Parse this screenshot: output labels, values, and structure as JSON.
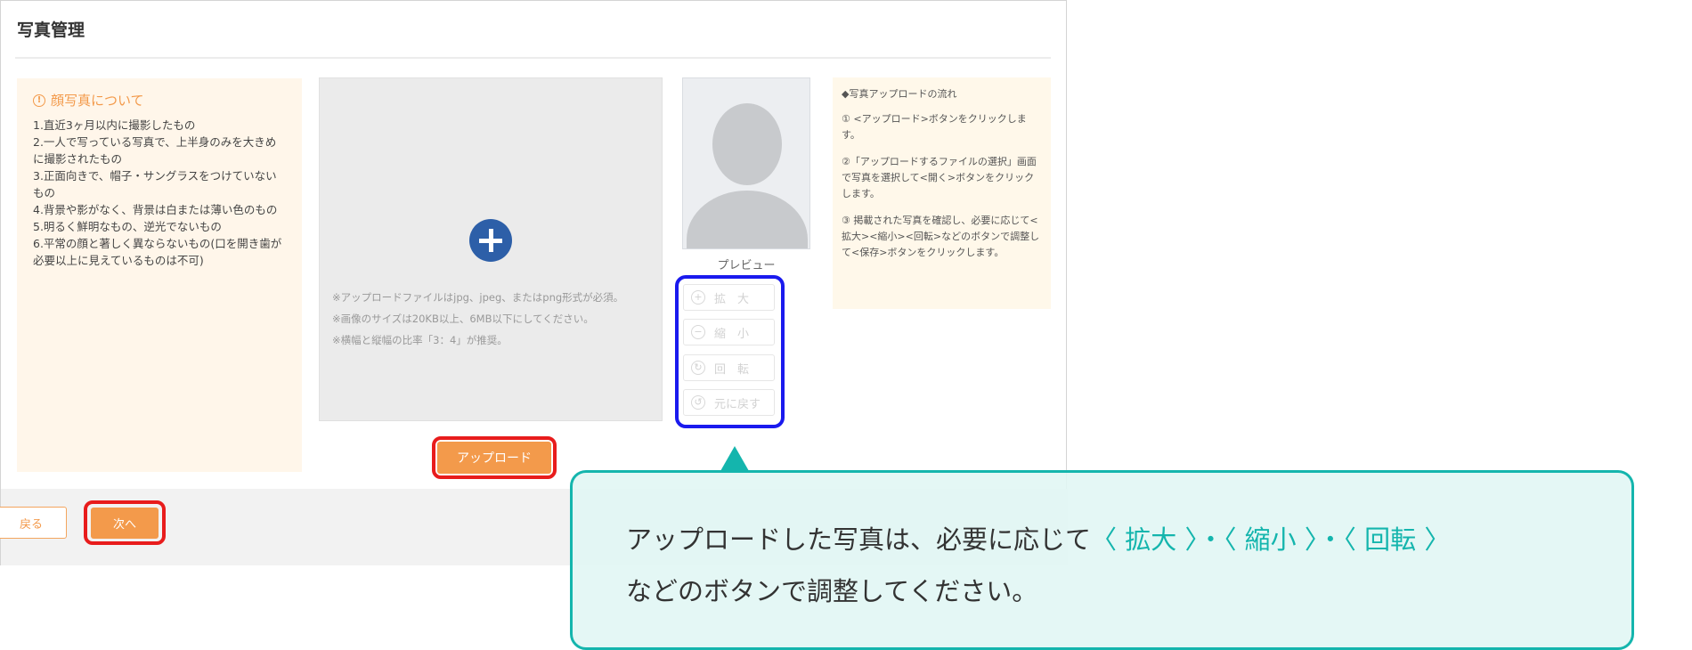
{
  "dialog": {
    "title": "写真管理"
  },
  "notice": {
    "icon": "info-icon",
    "heading": "顔写真について",
    "items": [
      "1.直近3ヶ月以内に撮影したもの",
      "2.一人で写っている写真で、上半身のみを大きめに撮影されたもの",
      "3.正面向きで、帽子・サングラスをつけていないもの",
      "4.背景や影がなく、背景は白または薄い色のもの",
      "5.明るく鮮明なもの、逆光でないもの",
      "6.平常の顔と著しく異ならないもの(口を開き歯が必要以上に見えているものは不可)"
    ]
  },
  "dropzone": {
    "icon": "plus-circle-icon",
    "notes": [
      "※アップロードファイルはjpg、jpeg、またはpng形式が必須。",
      "※画像のサイズは20KB以上、6MB以下にしてください。",
      "※横幅と縦幅の比率「3：4」が推奨。"
    ]
  },
  "upload_button": "アップロード",
  "preview": {
    "label": "プレビュー",
    "placeholder_icon": "person-silhouette-icon"
  },
  "tools": [
    {
      "label": "拡　大",
      "icon": "zoom-in-icon",
      "glyph": "+"
    },
    {
      "label": "縮　小",
      "icon": "zoom-out-icon",
      "glyph": "−"
    },
    {
      "label": "回　転",
      "icon": "rotate-icon",
      "glyph": "↻"
    },
    {
      "label": "元に戻す",
      "icon": "reset-icon",
      "glyph": "↺"
    }
  ],
  "flow": {
    "heading": "◆写真アップロードの流れ",
    "steps": [
      "① <アップロード>ボタンをクリックします。",
      "②「アップロードするファイルの選択」画面で写真を選択して<開く>ボタンをクリックします。",
      "③ 掲載された写真を確認し、必要に応じて<拡大><縮小><回転>などのボタンで調整して<保存>ボタンをクリックします。"
    ]
  },
  "footer": {
    "back_label": "戻る",
    "next_label": "次へ"
  },
  "callout": {
    "text_before": "アップロードした写真は、必要に応じて",
    "hl1": "〈 拡大 〉",
    "sep1": "・",
    "hl2": "〈 縮小 〉",
    "sep2": "・",
    "hl3": "〈 回転 〉",
    "line2": "などのボタンで調整してください。"
  },
  "colors": {
    "accent_orange": "#f39a4b",
    "highlight_red": "#e81c1c",
    "highlight_blue": "#1a1aee",
    "callout_teal": "#14b5ad"
  }
}
